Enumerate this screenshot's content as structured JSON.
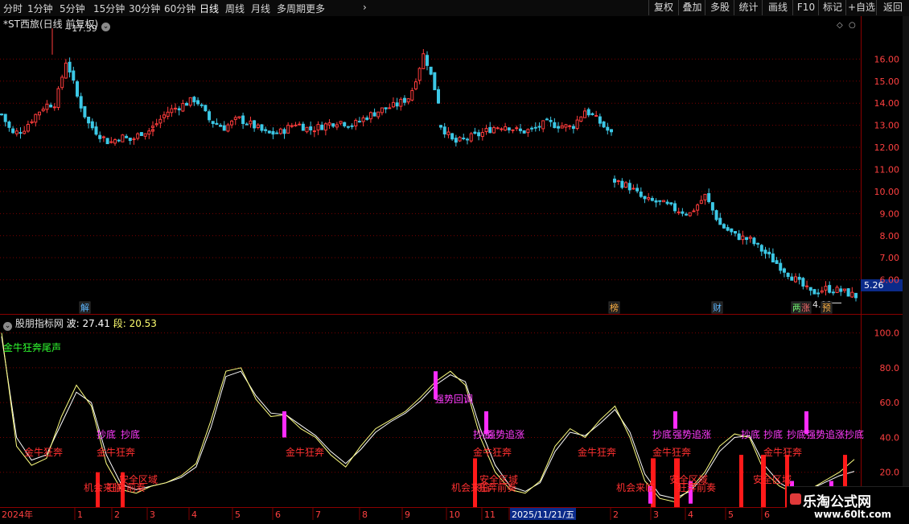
{
  "toolbar": {
    "periods": [
      "分时",
      "1分钟",
      "5分钟",
      "15分钟",
      "30分钟",
      "60分钟",
      "日线",
      "周线",
      "月线",
      "多周期",
      "更多"
    ],
    "active_period": "日线",
    "more_arrow": "›",
    "buttons": [
      "复权",
      "叠加",
      "多股",
      "统计",
      "画线",
      "F10",
      "标记",
      "+自选",
      "返回"
    ]
  },
  "main_panel": {
    "title": "*ST西旅(日线 前复权)",
    "high_label": "17.39",
    "low_label": "4.91",
    "current_price": "5.26",
    "event_markers": [
      {
        "text": "解",
        "color": "#5fb8ff"
      },
      {
        "text": "榜",
        "color": "#ffb347"
      },
      {
        "text": "财",
        "color": "#5fb8ff"
      },
      {
        "text": "两",
        "color": "#77ff77"
      },
      {
        "text": "涨",
        "color": "#ff7070"
      },
      {
        "text": "预",
        "color": "#ffb347"
      }
    ]
  },
  "indicator_panel": {
    "title": "股朋指标网",
    "wave_label": "波: 27.41",
    "segment_label": "段: 20.53",
    "corner_text": "金牛狂奔尾声",
    "signals": [
      {
        "text": "金牛狂奔",
        "color": "#ff3030"
      },
      {
        "text": "抄底",
        "color": "#ff3cff"
      },
      {
        "text": "抄底",
        "color": "#ff3cff"
      },
      {
        "text": "金牛狂奔",
        "color": "#ff3030"
      },
      {
        "text": "安全区域",
        "color": "#ff3030"
      },
      {
        "text": "机会来临",
        "color": "#ff3030"
      },
      {
        "text": "狂奔前奏",
        "color": "#ff3030"
      },
      {
        "text": "金牛狂奔",
        "color": "#ff3030"
      },
      {
        "text": "强势回调",
        "color": "#ff3cff"
      },
      {
        "text": "抄底",
        "color": "#ff3cff"
      },
      {
        "text": "强势追涨",
        "color": "#ff3cff"
      },
      {
        "text": "金牛狂奔",
        "color": "#ff3030"
      },
      {
        "text": "安全区域",
        "color": "#ff3030"
      },
      {
        "text": "机会来临",
        "color": "#ff3030"
      },
      {
        "text": "狂奔前奏",
        "color": "#ff3030"
      },
      {
        "text": "金牛狂奔",
        "color": "#ff3030"
      },
      {
        "text": "机会来临",
        "color": "#ff3030"
      },
      {
        "text": "抄底",
        "color": "#ff3cff"
      },
      {
        "text": "强势追涨",
        "color": "#ff3cff"
      },
      {
        "text": "金牛狂奔",
        "color": "#ff3030"
      },
      {
        "text": "安全区域",
        "color": "#ff3030"
      },
      {
        "text": "狂奔前奏",
        "color": "#ff3030"
      },
      {
        "text": "抄底",
        "color": "#ff3cff"
      },
      {
        "text": "抄底",
        "color": "#ff3cff"
      },
      {
        "text": "金牛狂奔",
        "color": "#ff3030"
      },
      {
        "text": "安全区域",
        "color": "#ff3030"
      },
      {
        "text": "抄底",
        "color": "#ff3cff"
      },
      {
        "text": "强势追涨",
        "color": "#ff3cff"
      },
      {
        "text": "抄底",
        "color": "#ff3cff"
      }
    ]
  },
  "date_axis": {
    "labels": [
      "2024年",
      "1",
      "2",
      "3",
      "4",
      "5",
      "6",
      "7",
      "8",
      "9",
      "10",
      "11",
      "2025/11/21/五",
      "2",
      "3",
      "4",
      "5",
      "6"
    ]
  },
  "watermark": {
    "title": "乐淘公式网",
    "url": "www.60lt.com"
  },
  "colors": {
    "up": "#ff3c3c",
    "down": "#3cc8e6",
    "grid": "#7a0000",
    "axis_text": "#ff4040",
    "wave_line": "#ffff80",
    "segment_line": "#ffffff",
    "magenta": "#ff2cff",
    "red_bar": "#ff1a1a"
  },
  "chart_data": [
    {
      "type": "candlestick",
      "title": "*ST西旅(日线 前复权)",
      "y_ticks": [
        16.0,
        15.0,
        14.0,
        13.0,
        12.0,
        11.0,
        10.0,
        9.0,
        8.0,
        7.0,
        6.0
      ],
      "ylim": [
        4.6,
        17.8
      ],
      "grid": true,
      "series": [
        {
          "segment": "2024-01 to 2024-03",
          "approx_close": [
            13.5,
            12.6,
            12.8,
            13.4,
            13.9,
            14.0,
            16.0,
            14.3,
            13.1,
            12.6,
            12.2,
            12.5,
            12.3,
            12.7,
            12.8
          ]
        },
        {
          "segment": "2024-04 to 2024-09",
          "approx_close": [
            12.9,
            13.6,
            13.9,
            14.2,
            13.2,
            12.9,
            13.3,
            13.0,
            12.6,
            12.7,
            13.1,
            12.8,
            13.0,
            13.2,
            13.0,
            13.4,
            13.7,
            13.9,
            14.3,
            16.3,
            14.1
          ]
        },
        {
          "segment": "2024-10 to 2025-11",
          "approx_close": [
            13.0,
            12.2,
            12.4,
            12.6,
            12.9,
            13.0,
            12.7,
            12.8,
            13.1,
            13.0,
            12.9,
            13.7,
            13.2,
            12.6
          ]
        },
        {
          "segment": "2025-11 to 2026-06",
          "approx_close": [
            10.5,
            10.2,
            9.6,
            9.5,
            9.2,
            9.0,
            9.8,
            8.5,
            8.0,
            7.8,
            7.2,
            6.6,
            6.0,
            5.4,
            5.6,
            5.5,
            5.26
          ]
        }
      ],
      "annotations": [
        {
          "text": "17.39"
        },
        {
          "text": "4.91"
        },
        {
          "text": "5.26"
        }
      ]
    },
    {
      "type": "line",
      "title": "股朋指标网",
      "y_ticks": [
        100.0,
        80.0,
        60.0,
        40.0,
        20.0
      ],
      "ylim": [
        0,
        110
      ],
      "grid": true,
      "series": [
        {
          "name": "波",
          "last": 27.41,
          "values": [
            100,
            35,
            24,
            28,
            52,
            70,
            58,
            25,
            10,
            8,
            12,
            14,
            18,
            25,
            50,
            78,
            80,
            62,
            52,
            53,
            45,
            40,
            30,
            23,
            35,
            45,
            50,
            55,
            63,
            72,
            78,
            70,
            40,
            20,
            10,
            8,
            15,
            35,
            45,
            40,
            50,
            58,
            40,
            15,
            5,
            3,
            10,
            20,
            35,
            42,
            40,
            20,
            12,
            8,
            10,
            15,
            20,
            27.41
          ]
        },
        {
          "name": "段",
          "last": 20.53,
          "values": [
            98,
            40,
            27,
            30,
            48,
            66,
            60,
            30,
            13,
            10,
            12,
            14,
            17,
            23,
            46,
            75,
            78,
            64,
            54,
            53,
            47,
            41,
            32,
            25,
            33,
            43,
            49,
            54,
            61,
            70,
            76,
            72,
            45,
            24,
            12,
            9,
            14,
            32,
            43,
            41,
            48,
            56,
            43,
            19,
            7,
            5,
            9,
            18,
            32,
            40,
            41,
            24,
            14,
            9,
            10,
            14,
            18,
            20.53
          ]
        }
      ],
      "markers": {
        "red_bars": 12,
        "magenta_bars": 9
      }
    }
  ]
}
